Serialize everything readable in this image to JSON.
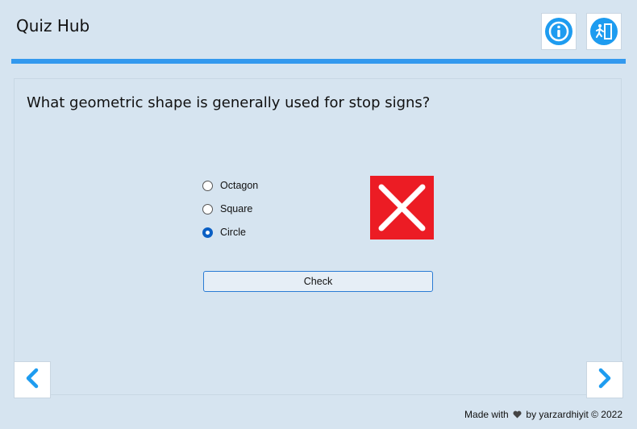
{
  "header": {
    "title": "Quiz Hub",
    "info_icon": "info-icon",
    "exit_icon": "exit-door-icon"
  },
  "quiz": {
    "question": "What geometric shape is generally used for stop signs?",
    "options": [
      {
        "label": "Octagon",
        "selected": false
      },
      {
        "label": "Square",
        "selected": false
      },
      {
        "label": "Circle",
        "selected": true
      }
    ],
    "check_label": "Check",
    "result": "wrong",
    "result_icon": "red-x-icon"
  },
  "nav": {
    "prev_icon": "chevron-left-icon",
    "next_icon": "chevron-right-icon"
  },
  "footer": {
    "made_with": "Made with",
    "heart_icon": "heart-icon",
    "credit": "by yarzardhiyit © 2022"
  },
  "colors": {
    "accent": "#3399ee",
    "icon_blue": "#1e9cf0",
    "wrong_red": "#ec1c24",
    "background": "#d6e4f0"
  }
}
